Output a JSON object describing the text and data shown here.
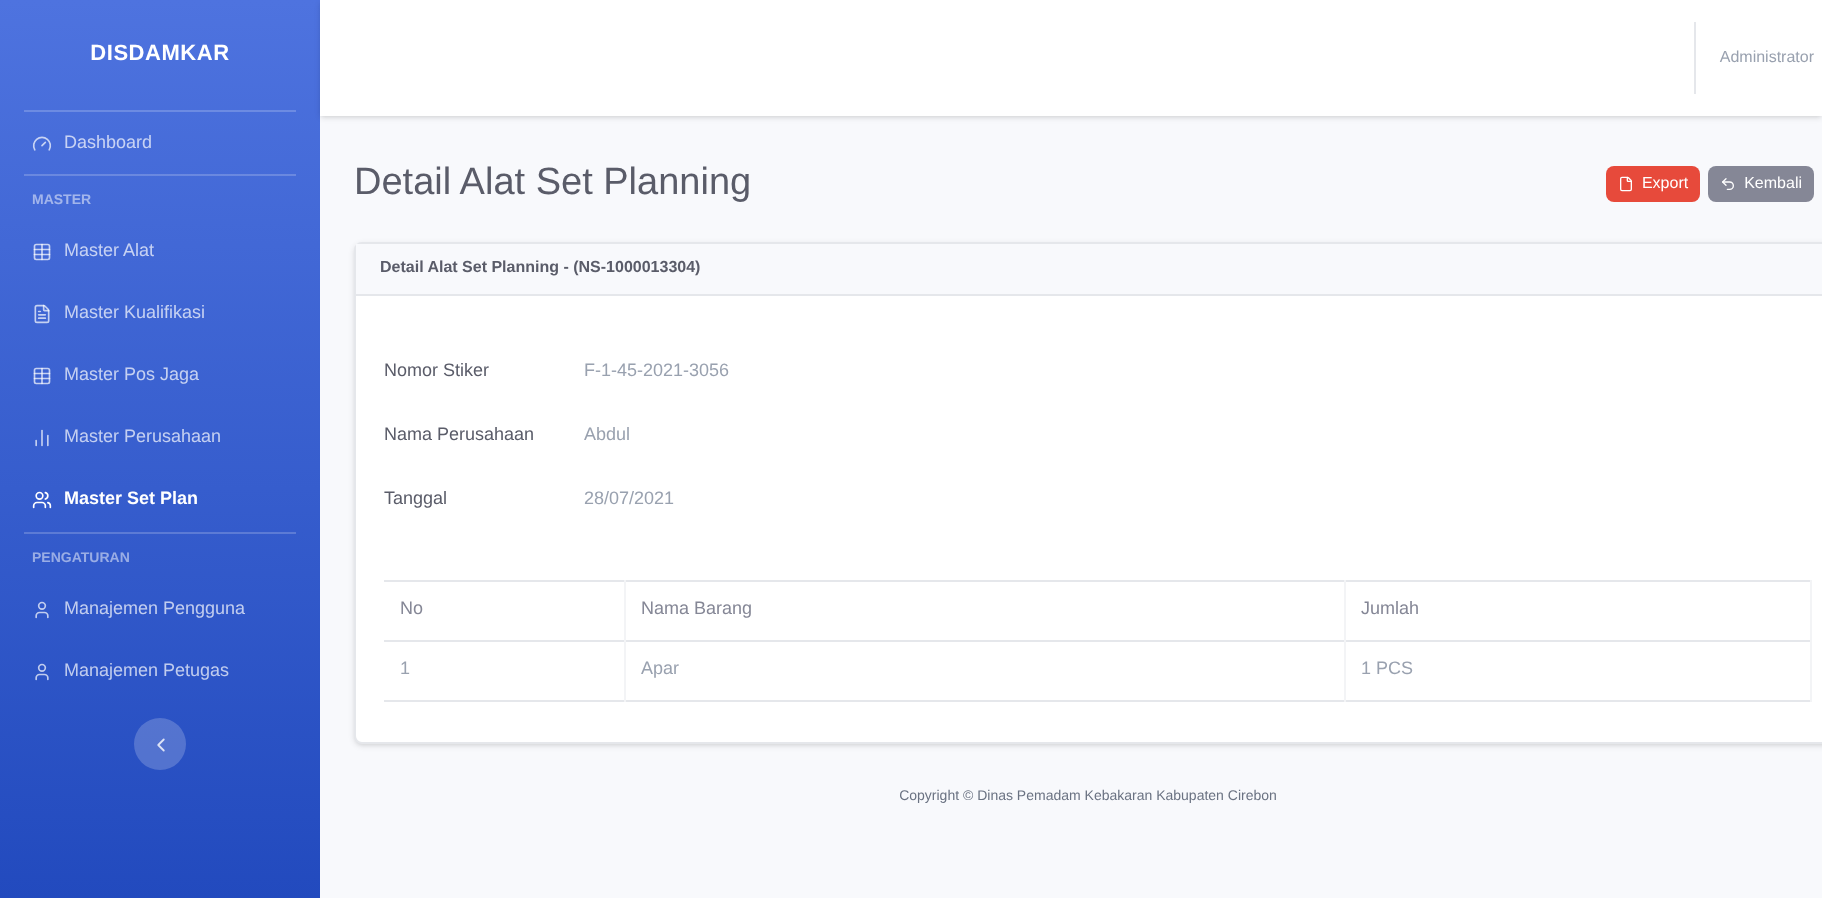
{
  "sidebar": {
    "brand": "DISDAMKAR",
    "sections": [
      {
        "items": [
          {
            "label": "Dashboard",
            "selected": false
          }
        ]
      },
      {
        "heading": "MASTER",
        "items": [
          {
            "label": "Master Alat",
            "selected": false
          },
          {
            "label": "Master Kualifikasi",
            "selected": false
          },
          {
            "label": "Master Pos Jaga",
            "selected": false
          },
          {
            "label": "Master Perusahaan",
            "selected": false
          },
          {
            "label": "Master Set Plan",
            "selected": true
          }
        ]
      },
      {
        "heading": "PENGATURAN",
        "items": [
          {
            "label": "Manajemen Pengguna",
            "selected": false
          },
          {
            "label": "Manajemen Petugas",
            "selected": false
          }
        ]
      }
    ]
  },
  "topbar": {
    "user": "Administrator"
  },
  "page": {
    "title": "Detail Alat Set Planning",
    "buttons": [
      {
        "label": "Export",
        "kind": "danger"
      },
      {
        "label": "Kembali",
        "kind": "secondary"
      }
    ]
  },
  "card": {
    "title": "Detail Alat Set Planning - (NS-1000013304)",
    "fields": [
      {
        "label": "Nomor Stiker",
        "value": "F-1-45-2021-3056"
      },
      {
        "label": "Nama Perusahaan",
        "value": "Abdul"
      },
      {
        "label": "Tanggal",
        "value": "28/07/2021"
      }
    ],
    "table": {
      "columns": [
        "No",
        "Nama Barang",
        "Jumlah"
      ],
      "rows": [
        [
          "1",
          "Apar",
          "1 PCS"
        ]
      ]
    }
  },
  "footer": "Copyright © Dinas Pemadam Kebakaran Kabupaten Cirebon"
}
